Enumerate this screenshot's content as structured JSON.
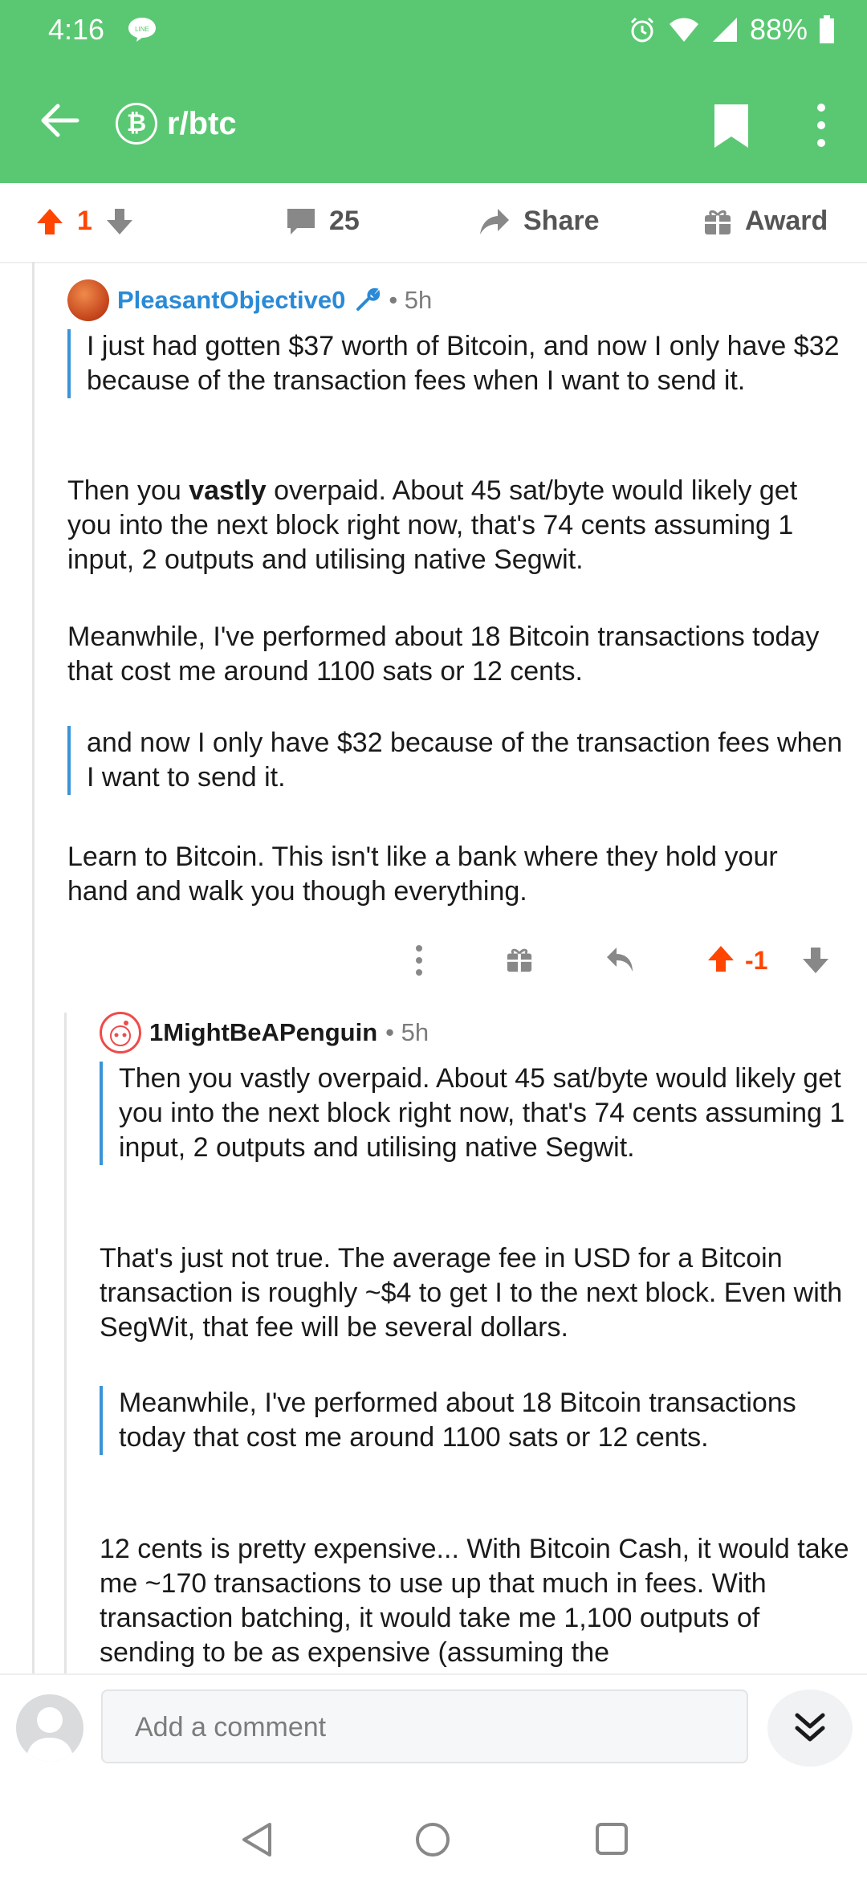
{
  "status_bar": {
    "time": "4:16",
    "line_badge": "LINE",
    "battery": "88%"
  },
  "header": {
    "subreddit": "r/btc",
    "btc_symbol": "₿"
  },
  "post_actions": {
    "upvotes": "1",
    "comments": "25",
    "share": "Share",
    "award": "Award"
  },
  "comment1": {
    "author": "PleasantObjective0",
    "age": "• 5h",
    "quote1": "I just had gotten $37 worth of Bitcoin, and now I only have $32 because of the transaction fees when I want to send it.",
    "p1_pre": "Then you ",
    "p1_bold": "vastly",
    "p1_post": " overpaid.  About 45 sat/byte would likely get you into the next block right now, that's 74 cents assuming 1 input, 2 outputs and utilising native Segwit.",
    "p2": "Meanwhile, I've performed about 18 Bitcoin transactions today that cost me around 1100 sats or 12 cents.",
    "quote2": "and now I only have $32 because of the transaction fees when I want to send it.",
    "p3": "Learn to Bitcoin.  This isn't like a bank where they hold your hand and walk you though everything.",
    "score": "-1"
  },
  "comment2": {
    "author": "1MightBeAPenguin",
    "age": "• 5h",
    "quote1": "Then you vastly overpaid. About 45 sat/byte would likely get you into the next block right now, that's 74 cents assuming 1 input, 2 outputs and utilising native Segwit.",
    "p1": "That's just not true. The average fee in USD for a Bitcoin transaction is roughly ~$4 to get I to the next block. Even with SegWit, that fee will be several dollars.",
    "quote2": "Meanwhile, I've performed about 18 Bitcoin transactions today that cost me around 1100 sats or 12 cents.",
    "p2": "12 cents is pretty expensive... With Bitcoin Cash, it would take me ~170 transactions to use up that much in fees. With transaction batching, it would take me 1,100 outputs of sending to be as expensive (assuming the"
  },
  "composer": {
    "placeholder": "Add a comment"
  },
  "colors": {
    "brand_green": "#5ac872",
    "upvote_orange": "#ff4500",
    "author_blue": "#2a8ad6",
    "quote_blue": "#3a94d6"
  }
}
